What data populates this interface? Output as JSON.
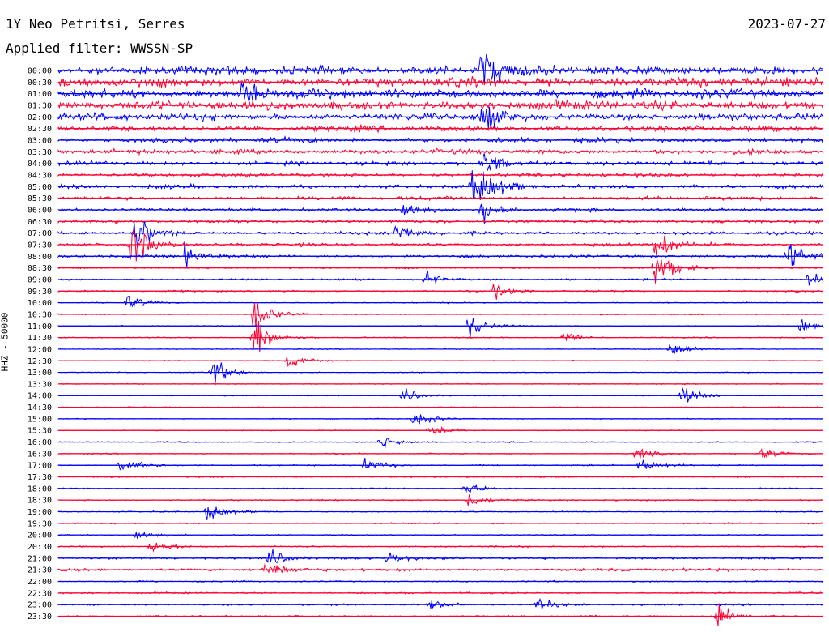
{
  "header": {
    "station": "1Y Neo Petritsi, Serres",
    "date": "2023-07-27",
    "filter": "Applied filter: WWSSN-SP"
  },
  "colors": {
    "trace_a": "#0000ff",
    "trace_b": "#ff0033",
    "background": "#ffffff",
    "text": "#000000"
  },
  "chart_data": {
    "type": "line",
    "title": "1Y Neo Petritsi, Serres",
    "ylabel": "HHZ - 50000",
    "grid": false,
    "legend": "none",
    "row_interval_minutes": 30,
    "colors_alternate": [
      "blue",
      "red"
    ],
    "row_labels": [
      "00:00",
      "00:30",
      "01:00",
      "01:30",
      "02:00",
      "02:30",
      "03:00",
      "03:30",
      "04:00",
      "04:30",
      "05:00",
      "05:30",
      "06:00",
      "06:30",
      "07:00",
      "07:30",
      "08:00",
      "08:30",
      "09:00",
      "09:30",
      "10:00",
      "10:30",
      "11:00",
      "11:30",
      "12:00",
      "12:30",
      "13:00",
      "13:30",
      "14:00",
      "14:30",
      "15:00",
      "15:30",
      "16:00",
      "16:30",
      "17:00",
      "17:30",
      "18:00",
      "18:30",
      "19:00",
      "19:30",
      "20:00",
      "20:30",
      "21:00",
      "21:30",
      "22:00",
      "22:30",
      "23:00",
      "23:30"
    ],
    "noise_level": [
      0.9,
      0.95,
      1.0,
      0.95,
      0.75,
      0.6,
      0.55,
      0.5,
      0.45,
      0.4,
      0.4,
      0.38,
      0.35,
      0.35,
      0.33,
      0.33,
      0.3,
      0.18,
      0.2,
      0.18,
      0.12,
      0.12,
      0.12,
      0.12,
      0.1,
      0.1,
      0.1,
      0.1,
      0.1,
      0.1,
      0.1,
      0.1,
      0.12,
      0.12,
      0.14,
      0.15,
      0.14,
      0.15,
      0.12,
      0.14,
      0.14,
      0.16,
      0.25,
      0.3,
      0.15,
      0.18,
      0.2,
      0.18
    ],
    "events": [
      {
        "row": 0,
        "pos": 0.553,
        "amp": 3.5
      },
      {
        "row": 2,
        "pos": 0.24,
        "amp": 1.5
      },
      {
        "row": 4,
        "pos": 0.553,
        "amp": 2.0
      },
      {
        "row": 8,
        "pos": 0.553,
        "amp": 2.2
      },
      {
        "row": 10,
        "pos": 0.553,
        "amp": 2.0
      },
      {
        "row": 10,
        "pos": 0.54,
        "amp": 1.6
      },
      {
        "row": 12,
        "pos": 0.553,
        "amp": 1.5
      },
      {
        "row": 12,
        "pos": 0.45,
        "amp": 1.2
      },
      {
        "row": 14,
        "pos": 0.1,
        "amp": 2.5
      },
      {
        "row": 14,
        "pos": 0.44,
        "amp": 1.3
      },
      {
        "row": 15,
        "pos": 0.095,
        "amp": 3.5
      },
      {
        "row": 15,
        "pos": 0.78,
        "amp": 2.0
      },
      {
        "row": 16,
        "pos": 0.165,
        "amp": 1.4
      },
      {
        "row": 16,
        "pos": 0.953,
        "amp": 2.0
      },
      {
        "row": 17,
        "pos": 0.78,
        "amp": 3.0
      },
      {
        "row": 18,
        "pos": 0.48,
        "amp": 1.0
      },
      {
        "row": 18,
        "pos": 0.98,
        "amp": 1.0
      },
      {
        "row": 19,
        "pos": 0.57,
        "amp": 1.0
      },
      {
        "row": 20,
        "pos": 0.09,
        "amp": 1.0
      },
      {
        "row": 21,
        "pos": 0.255,
        "amp": 2.5
      },
      {
        "row": 22,
        "pos": 0.535,
        "amp": 1.8
      },
      {
        "row": 22,
        "pos": 0.97,
        "amp": 1.0
      },
      {
        "row": 23,
        "pos": 0.255,
        "amp": 3.5
      },
      {
        "row": 23,
        "pos": 0.66,
        "amp": 0.8
      },
      {
        "row": 24,
        "pos": 0.8,
        "amp": 1.2
      },
      {
        "row": 25,
        "pos": 0.3,
        "amp": 1.0
      },
      {
        "row": 26,
        "pos": 0.2,
        "amp": 2.0
      },
      {
        "row": 28,
        "pos": 0.45,
        "amp": 1.0
      },
      {
        "row": 28,
        "pos": 0.815,
        "amp": 1.5
      },
      {
        "row": 30,
        "pos": 0.465,
        "amp": 1.2
      },
      {
        "row": 31,
        "pos": 0.485,
        "amp": 1.0
      },
      {
        "row": 32,
        "pos": 0.42,
        "amp": 1.0
      },
      {
        "row": 33,
        "pos": 0.755,
        "amp": 0.8
      },
      {
        "row": 33,
        "pos": 0.92,
        "amp": 0.8
      },
      {
        "row": 34,
        "pos": 0.08,
        "amp": 1.2
      },
      {
        "row": 34,
        "pos": 0.4,
        "amp": 0.9
      },
      {
        "row": 34,
        "pos": 0.76,
        "amp": 1.0
      },
      {
        "row": 36,
        "pos": 0.53,
        "amp": 1.0
      },
      {
        "row": 37,
        "pos": 0.535,
        "amp": 1.0
      },
      {
        "row": 38,
        "pos": 0.195,
        "amp": 1.5
      },
      {
        "row": 40,
        "pos": 0.1,
        "amp": 0.8
      },
      {
        "row": 41,
        "pos": 0.12,
        "amp": 0.8
      },
      {
        "row": 42,
        "pos": 0.275,
        "amp": 1.2
      },
      {
        "row": 42,
        "pos": 0.43,
        "amp": 1.0
      },
      {
        "row": 43,
        "pos": 0.27,
        "amp": 1.2
      },
      {
        "row": 46,
        "pos": 0.625,
        "amp": 1.0
      },
      {
        "row": 46,
        "pos": 0.485,
        "amp": 0.8
      },
      {
        "row": 47,
        "pos": 0.86,
        "amp": 1.8
      }
    ]
  }
}
